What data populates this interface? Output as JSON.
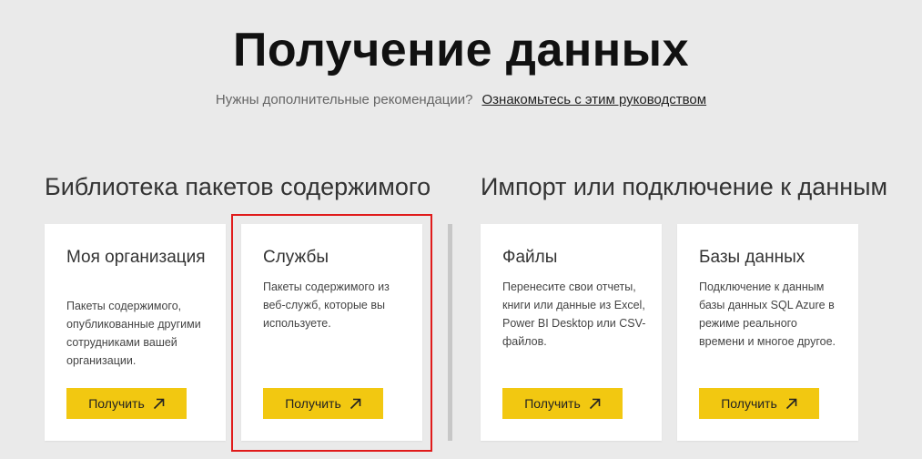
{
  "header": {
    "title": "Получение данных",
    "help_text": "Нужны дополнительные рекомендации?",
    "help_link": "Ознакомьтесь с этим руководством"
  },
  "sections": {
    "left_title": "Библиотека пакетов содержимого",
    "right_title": "Импорт или подключение к данным"
  },
  "cards": [
    {
      "title": "Моя организация",
      "description": "Пакеты содержимого, опубликованные другими сотрудниками вашей организации.",
      "button": "Получить"
    },
    {
      "title": "Службы",
      "description": "Пакеты содержимого из веб-служб, которые вы используете.",
      "button": "Получить"
    },
    {
      "title": "Файлы",
      "description": "Перенесите свои отчеты, книги или данные из Excel, Power BI Desktop или CSV-файлов.",
      "button": "Получить"
    },
    {
      "title": "Базы данных",
      "description": "Подключение к данным базы данных SQL Azure в режиме реального времени и многое другое.",
      "button": "Получить"
    }
  ],
  "colors": {
    "background": "#eaeaea",
    "button": "#f2c811",
    "highlight": "#e01b1b"
  },
  "icons": {
    "button_icon": "arrow-up-right-icon"
  }
}
